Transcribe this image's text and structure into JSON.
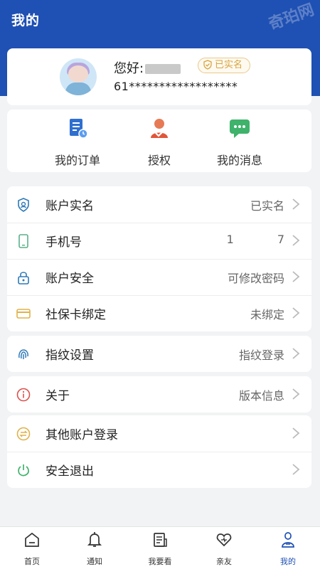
{
  "header": {
    "title": "我的",
    "watermark": "奇珀网"
  },
  "profile": {
    "greeting": "您好:",
    "badge": "已实名",
    "id_number": "61******************"
  },
  "quick_actions": [
    {
      "label": "我的订单",
      "icon": "order-icon"
    },
    {
      "label": "授权",
      "icon": "authorize-icon"
    },
    {
      "label": "我的消息",
      "icon": "message-icon"
    }
  ],
  "settings": [
    {
      "label": "账户实名",
      "value": "已实名",
      "icon": "shield-icon"
    },
    {
      "label": "手机号",
      "value": "1      7",
      "icon": "phone-icon"
    },
    {
      "label": "账户安全",
      "value": "可修改密码",
      "icon": "lock-icon"
    },
    {
      "label": "社保卡绑定",
      "value": "未绑定",
      "icon": "card-icon"
    }
  ],
  "fingerprint": {
    "label": "指纹设置",
    "value": "指纹登录",
    "icon": "fingerprint-icon"
  },
  "about": {
    "label": "关于",
    "value": "版本信息",
    "icon": "info-icon"
  },
  "other": [
    {
      "label": "其他账户登录",
      "value": "",
      "icon": "switch-account-icon"
    },
    {
      "label": "安全退出",
      "value": "",
      "icon": "power-icon"
    }
  ],
  "tabs": [
    {
      "label": "首页",
      "icon": "home-icon"
    },
    {
      "label": "通知",
      "icon": "bell-icon"
    },
    {
      "label": "我要看",
      "icon": "document-icon"
    },
    {
      "label": "亲友",
      "icon": "heart-icon"
    },
    {
      "label": "我的",
      "icon": "user-icon",
      "active": true
    }
  ],
  "colors": {
    "primary": "#1f50b3",
    "background": "#f2f3f5",
    "badge": "#d6a440"
  }
}
